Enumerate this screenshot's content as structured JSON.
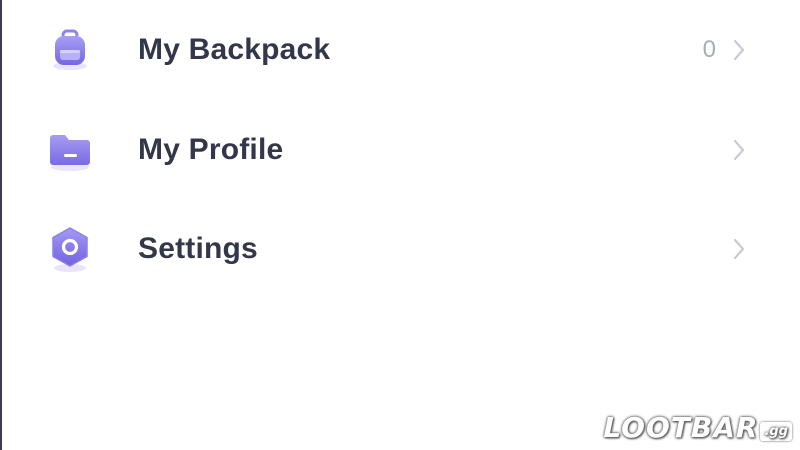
{
  "menu": {
    "items": [
      {
        "label": "My Backpack",
        "count": "0",
        "icon": "backpack-icon"
      },
      {
        "label": "My Profile",
        "count": "",
        "icon": "folder-icon"
      },
      {
        "label": "Settings",
        "count": "",
        "icon": "settings-hexagon-icon"
      }
    ]
  },
  "watermark": {
    "main": "LOOTBAR",
    "tld": ".gg"
  },
  "colors": {
    "accent": "#8e84ec",
    "accent_dark": "#7668e0",
    "text": "#34364a",
    "muted": "#a9acb8",
    "chevron": "#c9cbd3"
  }
}
